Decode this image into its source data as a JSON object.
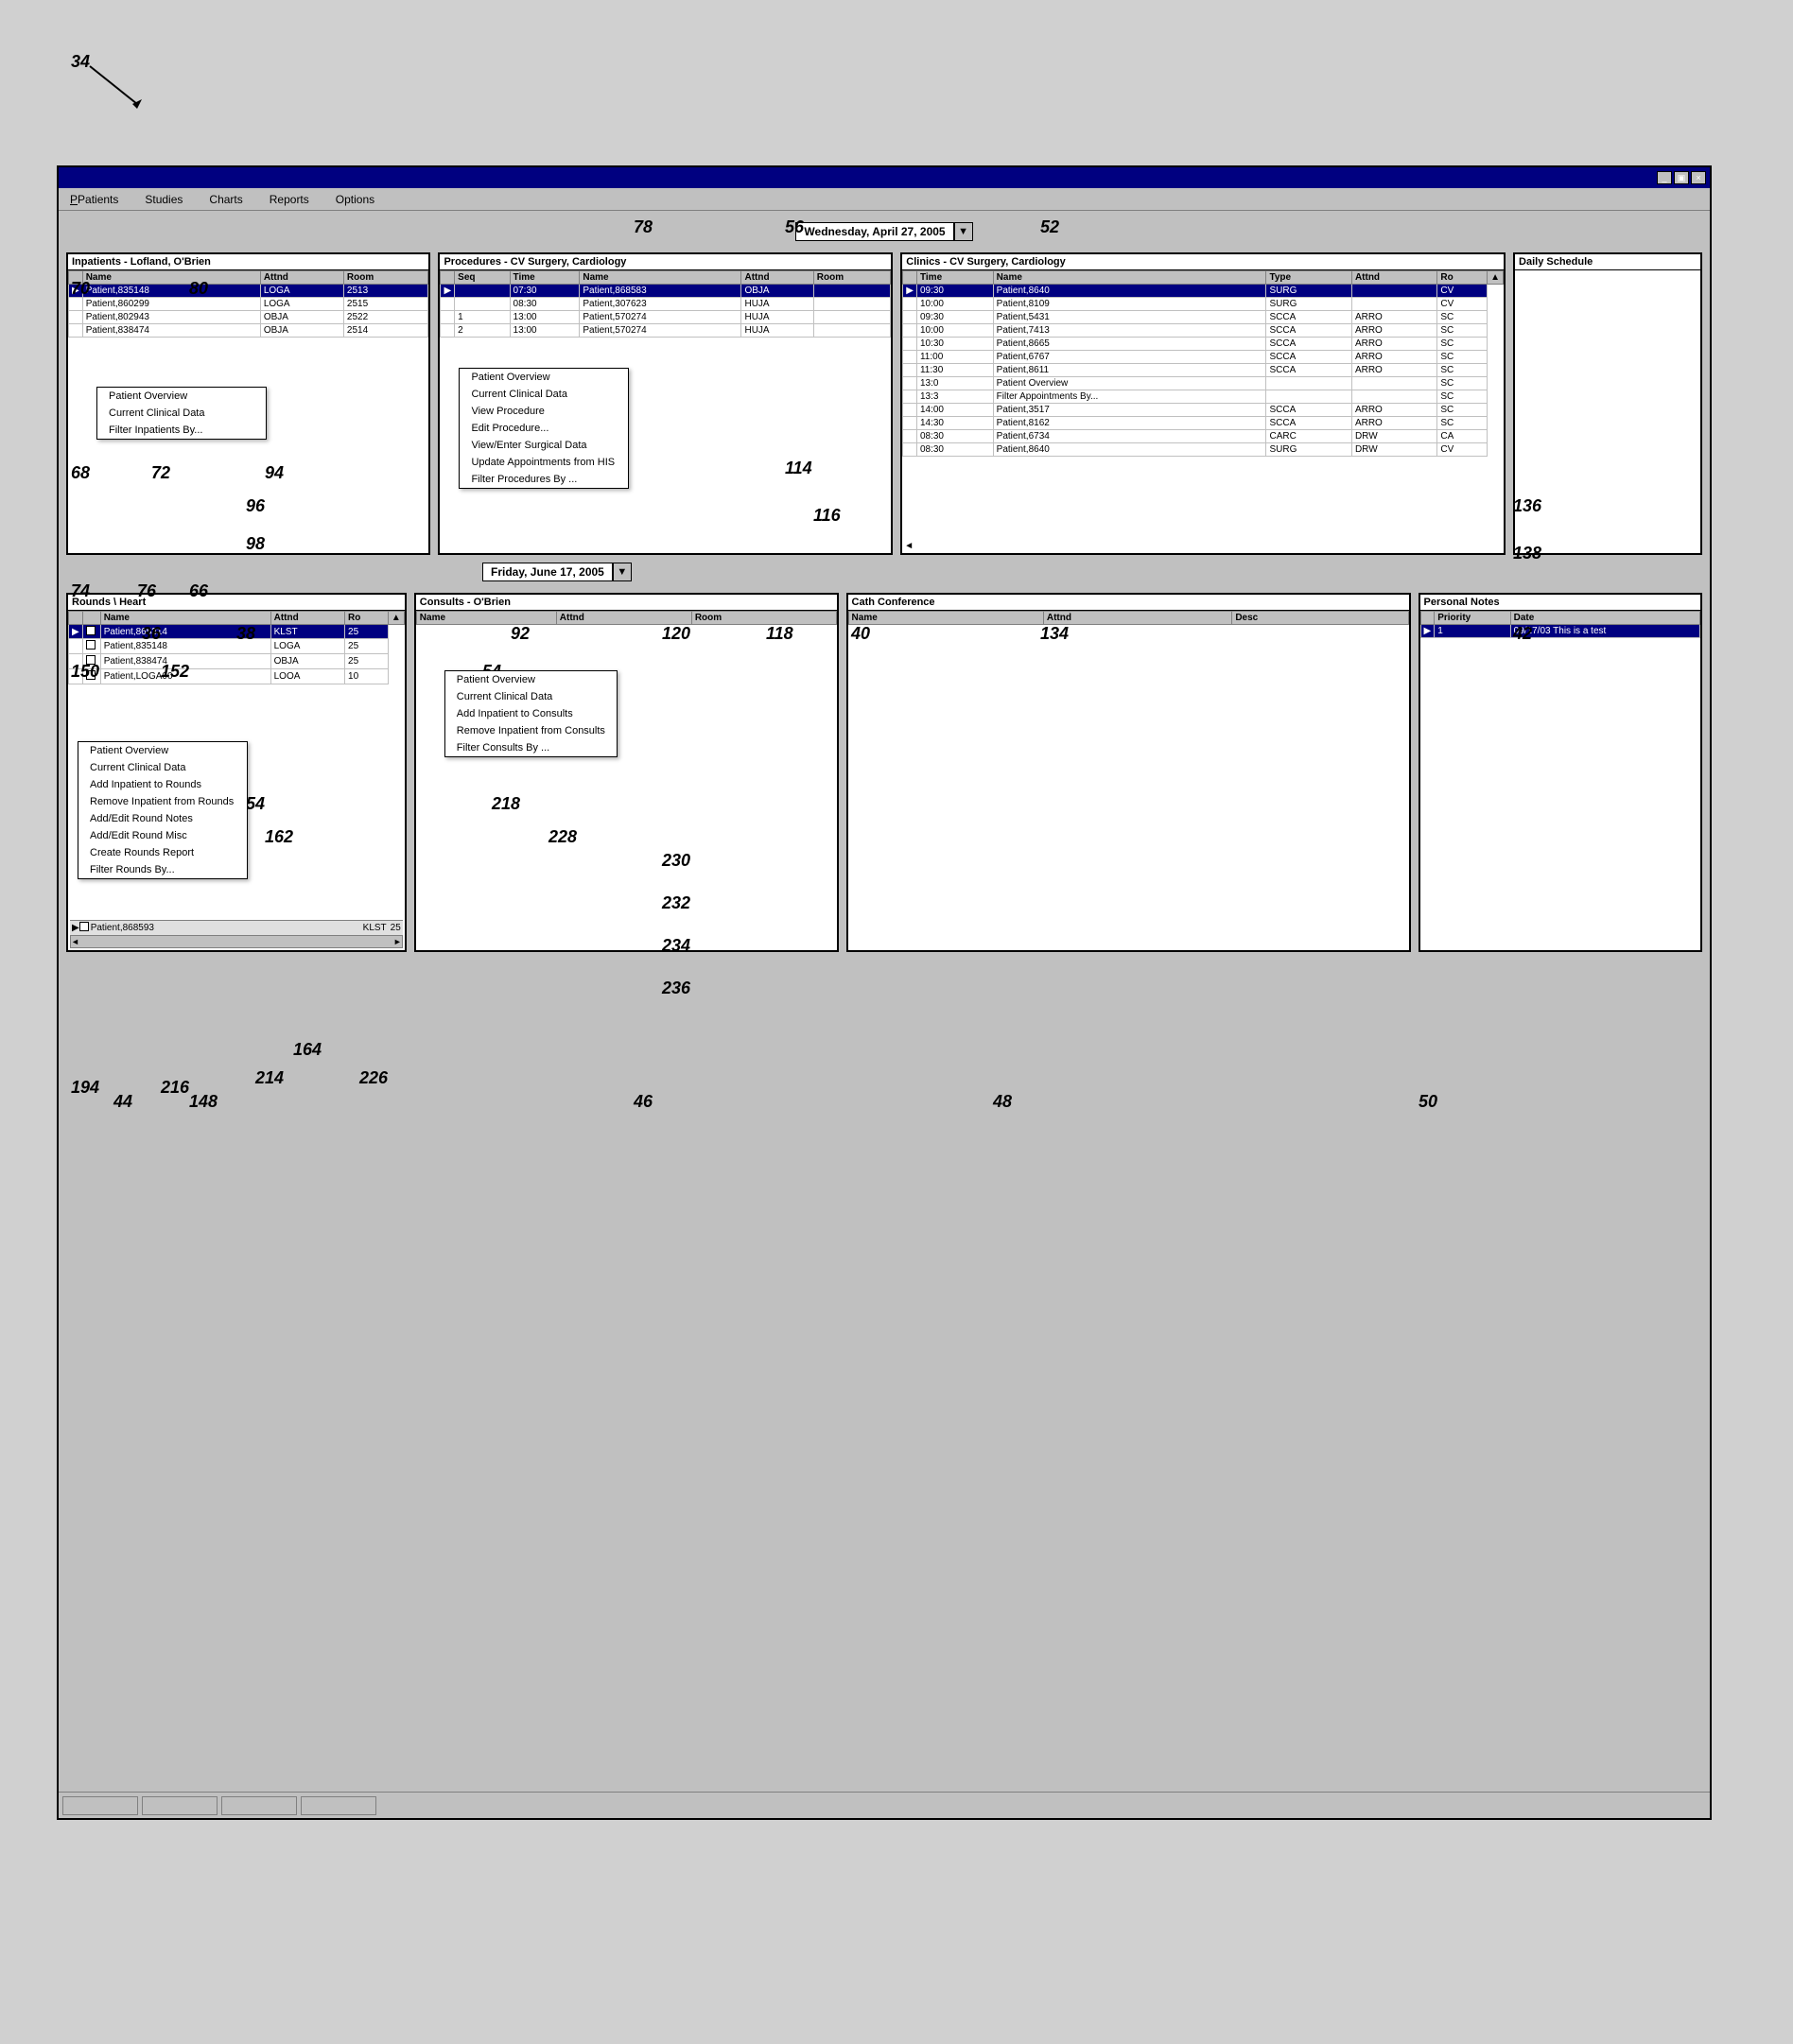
{
  "annotations": {
    "label_34": "34",
    "label_78": "78",
    "label_56": "56",
    "label_52": "52",
    "label_70": "70",
    "label_80": "80",
    "label_68": "68",
    "label_72": "72",
    "label_94": "94",
    "label_96": "96",
    "label_98": "98",
    "label_74": "74",
    "label_76": "76",
    "label_66": "66",
    "label_36": "36",
    "label_38": "38",
    "label_92": "92",
    "label_120": "120",
    "label_118": "118",
    "label_40": "40",
    "label_134": "134",
    "label_42": "42",
    "label_150": "150",
    "label_152": "152",
    "label_54": "54",
    "label_44": "44",
    "label_148": "148",
    "label_194": "194",
    "label_214": "214",
    "label_216": "216",
    "label_46": "46",
    "label_48": "48",
    "label_50": "50",
    "label_154": "154",
    "label_162": "162",
    "label_164": "164",
    "label_218": "218",
    "label_228": "228",
    "label_230": "230",
    "label_232": "232",
    "label_234": "234",
    "label_236": "236",
    "label_226": "226",
    "label_136": "136",
    "label_138": "138",
    "label_114": "114",
    "label_116": "116"
  },
  "menu": {
    "items": [
      "Patients",
      "Studies",
      "Charts",
      "Reports",
      "Options"
    ]
  },
  "top_date": {
    "label": "Wednesday,   April 27, 2005"
  },
  "bottom_date": {
    "label": "Friday,    June 17, 2005"
  },
  "inpatients_panel": {
    "title": "Inpatients - Lofland, O'Brien",
    "columns": [
      "Name",
      "Attnd",
      "Room"
    ],
    "rows": [
      {
        "indicator": "▶",
        "name": "Patient,835148",
        "attnd": "LOGA",
        "room": "2513"
      },
      {
        "indicator": "",
        "name": "Patient,860299",
        "attnd": "LOGA",
        "room": "2515"
      },
      {
        "indicator": "",
        "name": "Patient,802943",
        "attnd": "OBJA",
        "room": "2522"
      },
      {
        "indicator": "",
        "name": "Patient,838474",
        "attnd": "OBJA",
        "room": "2514"
      }
    ],
    "context_menu": [
      "Patient Overview",
      "Current Clinical Data",
      "Filter Inpatients By..."
    ]
  },
  "procedures_panel": {
    "title": "Procedures - CV Surgery, Cardiology",
    "columns": [
      "Seq",
      "Time",
      "Name",
      "Attnd",
      "Room"
    ],
    "rows": [
      {
        "indicator": "▶",
        "seq": "",
        "time": "07:30",
        "name": "Patient,868583",
        "attnd": "OBJA",
        "room": ""
      },
      {
        "indicator": "",
        "seq": "",
        "time": "08:30",
        "name": "Patient,307623",
        "attnd": "HUJA",
        "room": ""
      },
      {
        "indicator": "",
        "seq": "1",
        "time": "13:00",
        "name": "Patient,570274",
        "attnd": "HUJA",
        "room": ""
      },
      {
        "indicator": "",
        "seq": "2",
        "time": "13:00",
        "name": "Patient,570274",
        "attnd": "HUJA",
        "room": ""
      }
    ],
    "context_menu": [
      "Patient Overview",
      "Current Clinical Data",
      "View Procedure",
      "Edit Procedure...",
      "View/Enter Surgical Data",
      "Update Appointments from HIS",
      "Filter Procedures By ..."
    ]
  },
  "clinics_panel": {
    "title": "Clinics - CV Surgery, Cardiology",
    "columns": [
      "Time",
      "Name",
      "Type",
      "Attnd",
      "Ro"
    ],
    "rows": [
      {
        "indicator": "▶",
        "time": "09:30",
        "name": "Patient,8640",
        "type": "SURG",
        "attnd": "",
        "room": "CV"
      },
      {
        "indicator": "",
        "time": "10:00",
        "name": "Patient,8109",
        "type": "SURG",
        "attnd": "",
        "room": "CV"
      },
      {
        "indicator": "",
        "time": "09:30",
        "name": "Patient,5431",
        "type": "SCCA",
        "attnd": "ARRO",
        "room": "SC"
      },
      {
        "indicator": "",
        "time": "10:00",
        "name": "Patient,7413",
        "type": "SCCA",
        "attnd": "ARRO",
        "room": "SC"
      },
      {
        "indicator": "",
        "time": "10:30",
        "name": "Patient,8665",
        "type": "SCCA",
        "attnd": "ARRO",
        "room": "SC"
      },
      {
        "indicator": "",
        "time": "11:00",
        "name": "Patient,6767",
        "type": "SCCA",
        "attnd": "ARRO",
        "room": "SC"
      },
      {
        "indicator": "",
        "time": "11:30",
        "name": "Patient,8611",
        "type": "SCCA",
        "attnd": "ARRO",
        "room": "SC"
      },
      {
        "indicator": "",
        "time": "13:0",
        "name": "",
        "type": "",
        "attnd": "",
        "room": "SC"
      },
      {
        "indicator": "",
        "time": "13:3",
        "name": "",
        "type": "",
        "attnd": "",
        "room": "SC"
      },
      {
        "indicator": "",
        "time": "14:00",
        "name": "Patient,3517",
        "type": "SCCA",
        "attnd": "ARRO",
        "room": "SC"
      },
      {
        "indicator": "",
        "time": "14:30",
        "name": "Patient,8162",
        "type": "SCCA",
        "attnd": "ARRO",
        "room": "SC"
      },
      {
        "indicator": "",
        "time": "08:30",
        "name": "Patient,6734",
        "type": "CARC",
        "attnd": "DRW",
        "room": "CA"
      },
      {
        "indicator": "",
        "time": "08:30",
        "name": "Patient,8640",
        "type": "SURG",
        "attnd": "DRW",
        "room": "CV"
      }
    ],
    "context_menu": [
      "Patient Overview",
      "Filter Appointments By..."
    ]
  },
  "daily_schedule_panel": {
    "title": "Daily Schedule"
  },
  "rounds_panel": {
    "title": "Rounds \\ Heart",
    "columns": [
      "",
      "Name",
      "Attnd",
      "Ro"
    ],
    "rows": [
      {
        "indicator": "▶",
        "cb": true,
        "name": "Patient,865314",
        "attnd": "KLST",
        "room": "25"
      },
      {
        "indicator": "",
        "cb": false,
        "name": "Patient,835148",
        "attnd": "LOGA",
        "room": "25"
      },
      {
        "indicator": "",
        "cb": false,
        "name": "Patient,838474",
        "attnd": "OBJA",
        "room": "25"
      },
      {
        "indicator": "",
        "cb": false,
        "name": "Patient,LOGA00",
        "attnd": "LOOA",
        "room": "10"
      }
    ],
    "context_menu": [
      "Patient Overview",
      "Current Clinical Data",
      "Add Inpatient to Rounds",
      "Remove Inpatient from Rounds",
      "Add/Edit Round Notes",
      "Add/Edit Round Misc",
      "Create Rounds Report",
      "Filter Rounds By..."
    ],
    "bottom_row": "Patient,868593",
    "bottom_attnd": "KLST",
    "bottom_room": "25"
  },
  "consults_panel": {
    "title": "Consults - O'Brien",
    "columns": [
      "Name",
      "Attnd",
      "Room"
    ],
    "rows": [],
    "context_menu": [
      "Patient Overview",
      "Current Clinical Data",
      "Add Inpatient to Consults",
      "Remove Inpatient from Consults",
      "Filter Consults By ..."
    ]
  },
  "cath_conference_panel": {
    "title": "Cath Conference",
    "columns": [
      "Name",
      "Attnd",
      "Desc"
    ],
    "rows": []
  },
  "personal_notes_panel": {
    "title": "Personal Notes",
    "columns": [
      "Priority",
      "Date"
    ],
    "rows": [
      {
        "indicator": "▶",
        "priority": "1",
        "date": "09/17/03",
        "note": "This is a test"
      }
    ]
  },
  "status_bar": {
    "segments": [
      "",
      "",
      "",
      ""
    ]
  }
}
